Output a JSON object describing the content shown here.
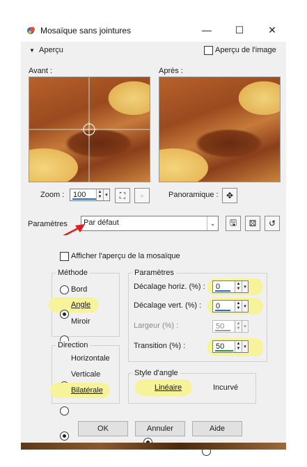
{
  "window": {
    "title": "Mosaïque sans jointures",
    "minimize": "—",
    "maximize": "☐",
    "close": "✕"
  },
  "preview": {
    "toggle_label": "Aperçu",
    "image_preview_label": "Aperçu de l'image",
    "image_preview_checked": false,
    "before_label": "Avant :",
    "after_label": "Après :",
    "zoom_label": "Zoom :",
    "zoom_value": "100",
    "pan_label": "Panoramique :"
  },
  "presets": {
    "label": "Paramètres",
    "selected": "Par défaut"
  },
  "options": {
    "tiling_preview_label": "Afficher l'aperçu de la mosaïque",
    "tiling_preview_checked": false
  },
  "method": {
    "title": "Méthode",
    "items": [
      {
        "label": "Bord",
        "checked": false
      },
      {
        "label": "Angle",
        "checked": true
      },
      {
        "label": "Miroir",
        "checked": false
      }
    ]
  },
  "direction": {
    "title": "Direction",
    "items": [
      {
        "label": "Horizontale",
        "checked": false
      },
      {
        "label": "Verticale",
        "checked": false
      },
      {
        "label": "Bilatérale",
        "checked": true
      }
    ]
  },
  "settings": {
    "title": "Paramètres",
    "h_offset_label": "Décalage horiz. (%) :",
    "h_offset_value": "0",
    "v_offset_label": "Décalage vert. (%) :",
    "v_offset_value": "0",
    "width_label": "Largeur (%) :",
    "width_value": "50",
    "transition_label": "Transition (%) :",
    "transition_value": "50"
  },
  "corner_style": {
    "title": "Style d'angle",
    "linear_label": "Linéaire",
    "linear_checked": true,
    "curved_label": "Incurvé",
    "curved_checked": false
  },
  "buttons": {
    "ok": "OK",
    "cancel": "Annuler",
    "help": "Aide"
  },
  "colors": {
    "highlight": "#f6f39a",
    "arrow": "#e41b1b",
    "accent_blue": "#1e6fd0",
    "accent_green": "#2a9d3a"
  }
}
